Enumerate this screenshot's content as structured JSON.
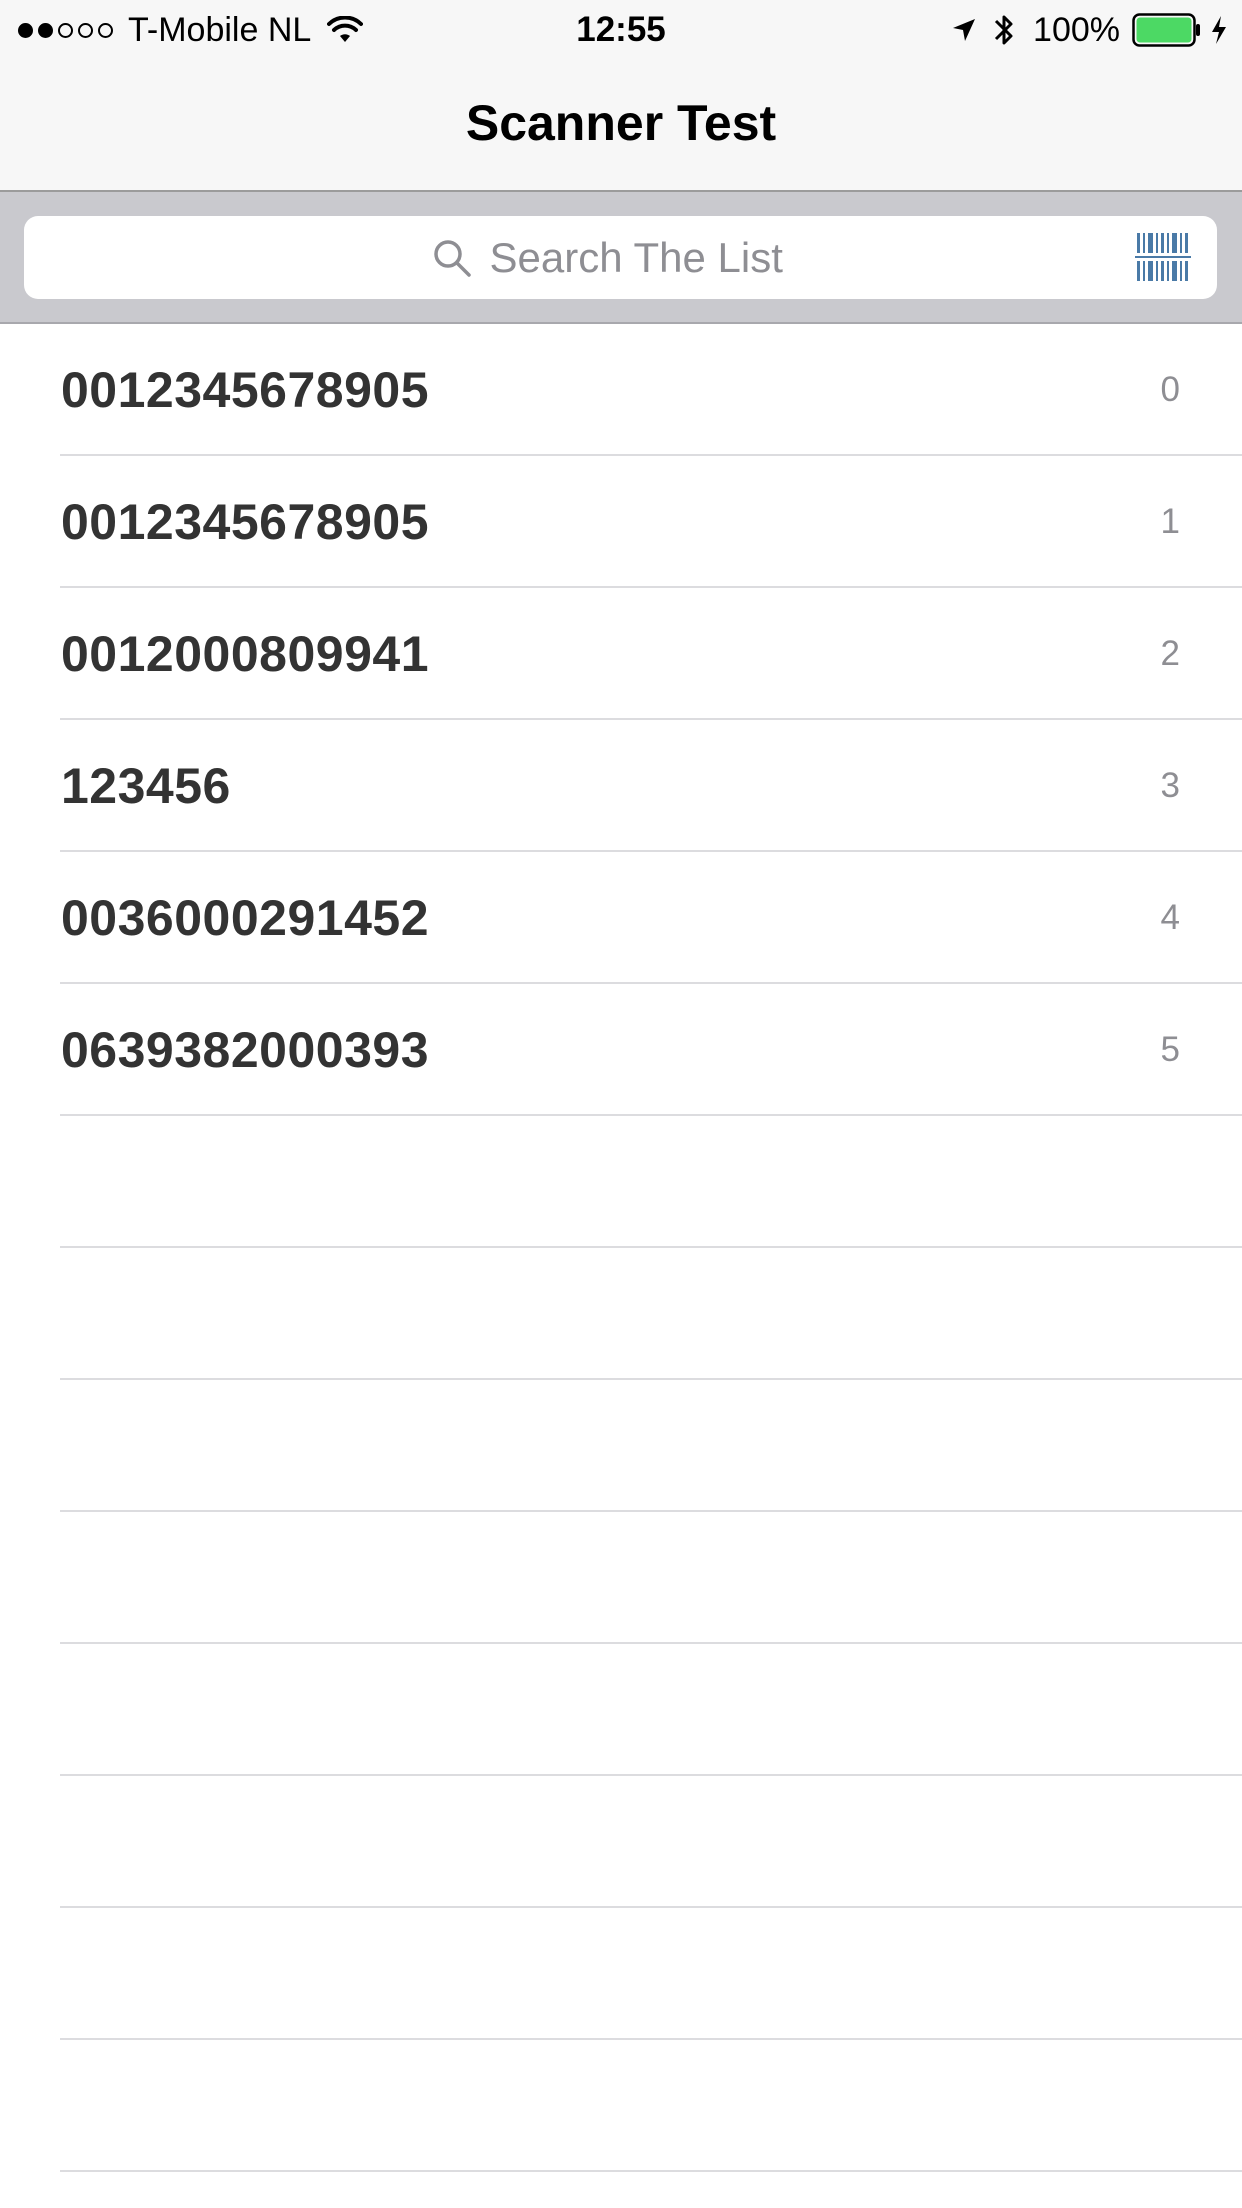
{
  "status_bar": {
    "carrier": "T-Mobile NL",
    "signal_bars": [
      true,
      true,
      false,
      false,
      false
    ],
    "time": "12:55",
    "battery_percent": "100%",
    "battery_level": 1.0,
    "battery_color": "#4cd964",
    "icons": [
      "wifi-icon",
      "location-icon",
      "bluetooth-icon",
      "battery-icon",
      "charging-icon"
    ]
  },
  "nav": {
    "title": "Scanner Test"
  },
  "search": {
    "placeholder": "Search The List",
    "value": "",
    "icon": "search-icon",
    "scan_icon": "barcode-icon",
    "scan_icon_color": "#4a7aa7"
  },
  "list": {
    "items": [
      {
        "code": "0012345678905",
        "index": "0"
      },
      {
        "code": "0012345678905",
        "index": "1"
      },
      {
        "code": "0012000809941",
        "index": "2"
      },
      {
        "code": "123456",
        "index": "3"
      },
      {
        "code": "0036000291452",
        "index": "4"
      },
      {
        "code": "0639382000393",
        "index": "5"
      }
    ],
    "empty_rows": 8
  }
}
